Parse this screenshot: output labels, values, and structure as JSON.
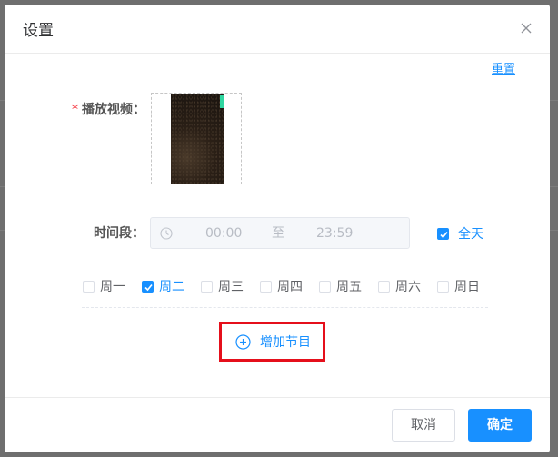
{
  "dialog": {
    "title": "设置",
    "reset_label": "重置"
  },
  "form": {
    "video_label": "播放视频：",
    "required_mark": "*",
    "time_label": "时间段：",
    "time_start": "00:00",
    "time_separator": "至",
    "time_end": "23:59",
    "all_day_label": "全天",
    "all_day_checked": true,
    "weekdays": [
      {
        "label": "周一",
        "checked": false
      },
      {
        "label": "周二",
        "checked": true
      },
      {
        "label": "周三",
        "checked": false
      },
      {
        "label": "周四",
        "checked": false
      },
      {
        "label": "周五",
        "checked": false
      },
      {
        "label": "周六",
        "checked": false
      },
      {
        "label": "周日",
        "checked": false
      }
    ],
    "add_program_label": "增加节目"
  },
  "footer": {
    "cancel_label": "取消",
    "ok_label": "确定"
  },
  "colors": {
    "accent": "#1890ff",
    "highlight_box": "#e50f1b",
    "required": "#f5222d"
  },
  "icons": {
    "close": "close-icon",
    "clock": "clock-icon",
    "add": "plus-circle-icon",
    "check": "check-icon"
  }
}
